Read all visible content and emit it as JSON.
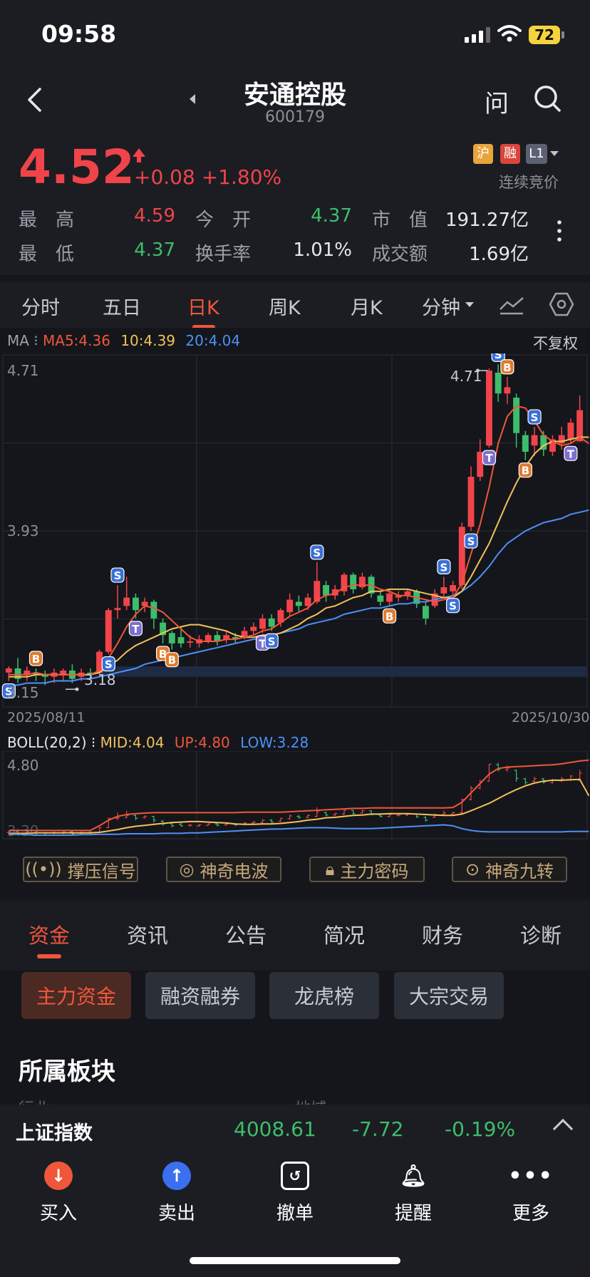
{
  "status_bar": {
    "time": "09:58",
    "battery": "72"
  },
  "header": {
    "title": "安通控股",
    "code": "600179",
    "ask_label": "问"
  },
  "quote": {
    "price": "4.52",
    "change": "+0.08 +1.80%",
    "badges": {
      "hu": "沪",
      "rong": "融",
      "level": "L1"
    },
    "status": "连续竞价",
    "stats": {
      "high_label": "最　高",
      "high": "4.59",
      "open_label": "今　开",
      "open": "4.37",
      "mktcap_label": "市　值",
      "mktcap": "191.27亿",
      "low_label": "最　低",
      "low": "4.37",
      "turnover_label": "换手率",
      "turnover": "1.01%",
      "amount_label": "成交额",
      "amount": "1.69亿"
    }
  },
  "kline_tabs": {
    "t1": "分时",
    "t2": "五日",
    "t3": "日K",
    "t4": "周K",
    "t5": "月K",
    "t6": "分钟"
  },
  "ma_legend": {
    "title": "MA",
    "ma5": "MA5:4.36",
    "ma10": "10:4.39",
    "ma20": "20:4.04",
    "fuquan": "不复权"
  },
  "chart_axes": {
    "y_top": "4.71",
    "y_mid": "3.93",
    "y_bottom": "3.15",
    "high_marker": "4.71",
    "low_marker": "3.18",
    "date_start": "2025/08/11",
    "date_end": "2025/10/30"
  },
  "boll_legend": {
    "title": "BOLL(20,2)",
    "mid": "MID:4.04",
    "up": "UP:4.80",
    "low": "LOW:3.28",
    "y_top": "4.80",
    "y_bottom": "3.30"
  },
  "indicator_buttons": {
    "b1": "撑压信号",
    "b2": "神奇电波",
    "b3": "主力密码",
    "b4": "神奇九转"
  },
  "section_tabs": {
    "s1": "资金",
    "s2": "资讯",
    "s3": "公告",
    "s4": "简况",
    "s5": "财务",
    "s6": "诊断"
  },
  "chips": {
    "c1": "主力资金",
    "c2": "融资融券",
    "c3": "龙虎榜",
    "c4": "大宗交易"
  },
  "section_title": "所属板块",
  "faded_labels": {
    "left": "行业",
    "right": "地域"
  },
  "index_bar": {
    "name": "上证指数",
    "value": "4008.61",
    "change": "-7.72",
    "pct": "-0.19%"
  },
  "toolbar": {
    "buy": "买入",
    "sell": "卖出",
    "cancel": "撤单",
    "alert": "提醒",
    "more": "更多"
  },
  "colors": {
    "up": "#f0444a",
    "down": "#3dbd6b",
    "accent": "#f0563a",
    "ma5": "#f0563a",
    "ma10": "#f3c15a",
    "ma20": "#4f8ff7"
  },
  "chart_data": {
    "type": "candlestick",
    "x_range": [
      "2025/08/11",
      "2025/10/30"
    ],
    "ylim": [
      3.15,
      4.71
    ],
    "candles": [
      {
        "o": 3.26,
        "c": 3.28,
        "h": 3.29,
        "l": 3.22
      },
      {
        "o": 3.28,
        "c": 3.23,
        "h": 3.33,
        "l": 3.21
      },
      {
        "o": 3.25,
        "c": 3.27,
        "h": 3.29,
        "l": 3.22
      },
      {
        "o": 3.26,
        "c": 3.25,
        "h": 3.28,
        "l": 3.22
      },
      {
        "o": 3.25,
        "c": 3.24,
        "h": 3.27,
        "l": 3.2
      },
      {
        "o": 3.24,
        "c": 3.26,
        "h": 3.28,
        "l": 3.21
      },
      {
        "o": 3.25,
        "c": 3.27,
        "h": 3.28,
        "l": 3.22
      },
      {
        "o": 3.27,
        "c": 3.23,
        "h": 3.3,
        "l": 3.21
      },
      {
        "o": 3.24,
        "c": 3.26,
        "h": 3.28,
        "l": 3.22
      },
      {
        "o": 3.26,
        "c": 3.25,
        "h": 3.28,
        "l": 3.23
      },
      {
        "o": 3.26,
        "c": 3.36,
        "h": 3.37,
        "l": 3.25
      },
      {
        "o": 3.36,
        "c": 3.56,
        "h": 3.57,
        "l": 3.35
      },
      {
        "o": 3.56,
        "c": 3.57,
        "h": 3.68,
        "l": 3.52
      },
      {
        "o": 3.58,
        "c": 3.62,
        "h": 3.72,
        "l": 3.56
      },
      {
        "o": 3.62,
        "c": 3.56,
        "h": 3.64,
        "l": 3.52
      },
      {
        "o": 3.58,
        "c": 3.6,
        "h": 3.62,
        "l": 3.55
      },
      {
        "o": 3.6,
        "c": 3.52,
        "h": 3.61,
        "l": 3.47
      },
      {
        "o": 3.5,
        "c": 3.44,
        "h": 3.52,
        "l": 3.4
      },
      {
        "o": 3.45,
        "c": 3.4,
        "h": 3.46,
        "l": 3.37
      },
      {
        "o": 3.43,
        "c": 3.4,
        "h": 3.48,
        "l": 3.38
      },
      {
        "o": 3.41,
        "c": 3.41,
        "h": 3.44,
        "l": 3.38
      },
      {
        "o": 3.4,
        "c": 3.42,
        "h": 3.44,
        "l": 3.38
      },
      {
        "o": 3.41,
        "c": 3.44,
        "h": 3.45,
        "l": 3.4
      },
      {
        "o": 3.44,
        "c": 3.41,
        "h": 3.46,
        "l": 3.39
      },
      {
        "o": 3.42,
        "c": 3.44,
        "h": 3.46,
        "l": 3.4
      },
      {
        "o": 3.43,
        "c": 3.42,
        "h": 3.45,
        "l": 3.4
      },
      {
        "o": 3.43,
        "c": 3.46,
        "h": 3.48,
        "l": 3.42
      },
      {
        "o": 3.46,
        "c": 3.48,
        "h": 3.5,
        "l": 3.44
      },
      {
        "o": 3.47,
        "c": 3.52,
        "h": 3.54,
        "l": 3.45
      },
      {
        "o": 3.52,
        "c": 3.48,
        "h": 3.54,
        "l": 3.46
      },
      {
        "o": 3.5,
        "c": 3.56,
        "h": 3.57,
        "l": 3.48
      },
      {
        "o": 3.55,
        "c": 3.61,
        "h": 3.64,
        "l": 3.53
      },
      {
        "o": 3.6,
        "c": 3.58,
        "h": 3.63,
        "l": 3.55
      },
      {
        "o": 3.58,
        "c": 3.62,
        "h": 3.64,
        "l": 3.56
      },
      {
        "o": 3.6,
        "c": 3.7,
        "h": 3.79,
        "l": 3.59
      },
      {
        "o": 3.68,
        "c": 3.63,
        "h": 3.7,
        "l": 3.6
      },
      {
        "o": 3.63,
        "c": 3.66,
        "h": 3.68,
        "l": 3.61
      },
      {
        "o": 3.65,
        "c": 3.73,
        "h": 3.74,
        "l": 3.63
      },
      {
        "o": 3.73,
        "c": 3.66,
        "h": 3.74,
        "l": 3.64
      },
      {
        "o": 3.67,
        "c": 3.72,
        "h": 3.74,
        "l": 3.66
      },
      {
        "o": 3.72,
        "c": 3.64,
        "h": 3.73,
        "l": 3.62
      },
      {
        "o": 3.63,
        "c": 3.6,
        "h": 3.65,
        "l": 3.58
      },
      {
        "o": 3.6,
        "c": 3.64,
        "h": 3.66,
        "l": 3.58
      },
      {
        "o": 3.62,
        "c": 3.63,
        "h": 3.65,
        "l": 3.6
      },
      {
        "o": 3.63,
        "c": 3.65,
        "h": 3.66,
        "l": 3.61
      },
      {
        "o": 3.65,
        "c": 3.59,
        "h": 3.66,
        "l": 3.57
      },
      {
        "o": 3.58,
        "c": 3.52,
        "h": 3.6,
        "l": 3.49
      },
      {
        "o": 3.58,
        "c": 3.64,
        "h": 3.66,
        "l": 3.57
      },
      {
        "o": 3.64,
        "c": 3.67,
        "h": 3.72,
        "l": 3.62
      },
      {
        "o": 3.65,
        "c": 3.68,
        "h": 3.7,
        "l": 3.63
      },
      {
        "o": 3.68,
        "c": 3.96,
        "h": 3.98,
        "l": 3.66
      },
      {
        "o": 3.96,
        "c": 4.2,
        "h": 4.25,
        "l": 3.94
      },
      {
        "o": 4.2,
        "c": 4.32,
        "h": 4.38,
        "l": 4.18
      },
      {
        "o": 4.35,
        "c": 4.71,
        "h": 4.72,
        "l": 4.34
      },
      {
        "o": 4.7,
        "c": 4.6,
        "h": 4.74,
        "l": 4.56
      },
      {
        "o": 4.6,
        "c": 4.63,
        "h": 4.68,
        "l": 4.55
      },
      {
        "o": 4.58,
        "c": 4.41,
        "h": 4.6,
        "l": 4.34
      },
      {
        "o": 4.4,
        "c": 4.32,
        "h": 4.42,
        "l": 4.28
      },
      {
        "o": 4.35,
        "c": 4.4,
        "h": 4.44,
        "l": 4.3
      },
      {
        "o": 4.4,
        "c": 4.33,
        "h": 4.42,
        "l": 4.3
      },
      {
        "o": 4.32,
        "c": 4.38,
        "h": 4.4,
        "l": 4.3
      },
      {
        "o": 4.36,
        "c": 4.4,
        "h": 4.44,
        "l": 4.33
      },
      {
        "o": 4.38,
        "c": 4.46,
        "h": 4.48,
        "l": 4.36
      },
      {
        "o": 4.37,
        "c": 4.52,
        "h": 4.59,
        "l": 4.37
      }
    ],
    "ma5": [
      3.25,
      3.25,
      3.25,
      3.26,
      3.25,
      3.25,
      3.25,
      3.25,
      3.25,
      3.25,
      3.27,
      3.33,
      3.4,
      3.48,
      3.54,
      3.58,
      3.57,
      3.55,
      3.51,
      3.47,
      3.43,
      3.41,
      3.41,
      3.41,
      3.42,
      3.42,
      3.43,
      3.44,
      3.46,
      3.47,
      3.5,
      3.53,
      3.55,
      3.57,
      3.61,
      3.63,
      3.64,
      3.67,
      3.68,
      3.68,
      3.68,
      3.66,
      3.65,
      3.63,
      3.63,
      3.62,
      3.61,
      3.6,
      3.61,
      3.62,
      3.69,
      3.83,
      3.97,
      4.15,
      4.36,
      4.49,
      4.54,
      4.53,
      4.47,
      4.4,
      4.37,
      4.35,
      4.36,
      4.39,
      4.36
    ],
    "ma10": [
      3.24,
      3.24,
      3.24,
      3.25,
      3.25,
      3.25,
      3.25,
      3.25,
      3.25,
      3.25,
      3.26,
      3.29,
      3.32,
      3.36,
      3.39,
      3.41,
      3.43,
      3.45,
      3.47,
      3.48,
      3.49,
      3.49,
      3.48,
      3.47,
      3.46,
      3.44,
      3.43,
      3.43,
      3.44,
      3.44,
      3.45,
      3.47,
      3.49,
      3.52,
      3.54,
      3.57,
      3.58,
      3.6,
      3.62,
      3.63,
      3.65,
      3.65,
      3.66,
      3.66,
      3.66,
      3.65,
      3.64,
      3.63,
      3.62,
      3.62,
      3.65,
      3.72,
      3.8,
      3.88,
      3.98,
      4.08,
      4.17,
      4.25,
      4.31,
      4.35,
      4.37,
      4.37,
      4.38,
      4.39,
      4.39
    ],
    "ma20": [
      3.2,
      3.2,
      3.21,
      3.21,
      3.21,
      3.22,
      3.22,
      3.22,
      3.23,
      3.23,
      3.24,
      3.25,
      3.26,
      3.27,
      3.28,
      3.3,
      3.31,
      3.32,
      3.33,
      3.34,
      3.35,
      3.36,
      3.37,
      3.38,
      3.39,
      3.4,
      3.41,
      3.42,
      3.43,
      3.44,
      3.45,
      3.46,
      3.47,
      3.49,
      3.5,
      3.51,
      3.52,
      3.54,
      3.55,
      3.56,
      3.57,
      3.57,
      3.58,
      3.59,
      3.59,
      3.6,
      3.6,
      3.61,
      3.62,
      3.63,
      3.65,
      3.68,
      3.72,
      3.77,
      3.83,
      3.88,
      3.91,
      3.94,
      3.96,
      3.98,
      3.99,
      4.0,
      4.02,
      4.03,
      4.04
    ],
    "signals": [
      {
        "i": 0,
        "t": "S",
        "p": "below"
      },
      {
        "i": 3,
        "t": "B",
        "p": "above"
      },
      {
        "i": 11,
        "t": "S",
        "p": "below"
      },
      {
        "i": 12,
        "t": "S",
        "p": "above"
      },
      {
        "i": 14,
        "t": "T",
        "p": "below"
      },
      {
        "i": 17,
        "t": "B",
        "p": "below"
      },
      {
        "i": 18,
        "t": "B",
        "p": "below"
      },
      {
        "i": 28,
        "t": "T",
        "p": "below"
      },
      {
        "i": 29,
        "t": "S",
        "p": "below"
      },
      {
        "i": 34,
        "t": "S",
        "p": "above"
      },
      {
        "i": 42,
        "t": "B",
        "p": "below"
      },
      {
        "i": 48,
        "t": "S",
        "p": "above"
      },
      {
        "i": 49,
        "t": "S",
        "p": "below"
      },
      {
        "i": 51,
        "t": "S",
        "p": "below"
      },
      {
        "i": 53,
        "t": "T",
        "p": "below"
      },
      {
        "i": 54,
        "t": "S",
        "p": "above"
      },
      {
        "i": 55,
        "t": "B",
        "p": "above"
      },
      {
        "i": 57,
        "t": "B",
        "p": "below"
      },
      {
        "i": 58,
        "t": "S",
        "p": "above"
      },
      {
        "i": 62,
        "t": "T",
        "p": "below"
      }
    ],
    "boll": {
      "ylim": [
        3.2,
        4.9
      ],
      "up": [
        3.3,
        3.3,
        3.3,
        3.3,
        3.3,
        3.3,
        3.3,
        3.3,
        3.3,
        3.3,
        3.4,
        3.52,
        3.6,
        3.64,
        3.66,
        3.67,
        3.68,
        3.68,
        3.68,
        3.68,
        3.68,
        3.68,
        3.68,
        3.68,
        3.68,
        3.68,
        3.69,
        3.69,
        3.69,
        3.69,
        3.69,
        3.7,
        3.71,
        3.72,
        3.73,
        3.74,
        3.75,
        3.76,
        3.77,
        3.77,
        3.78,
        3.78,
        3.78,
        3.78,
        3.78,
        3.78,
        3.78,
        3.78,
        3.78,
        3.79,
        3.9,
        4.1,
        4.3,
        4.5,
        4.62,
        4.65,
        4.66,
        4.67,
        4.68,
        4.69,
        4.7,
        4.72,
        4.75,
        4.78,
        4.8
      ],
      "mid": [
        3.24,
        3.24,
        3.24,
        3.25,
        3.25,
        3.25,
        3.25,
        3.25,
        3.25,
        3.25,
        3.26,
        3.29,
        3.32,
        3.36,
        3.39,
        3.41,
        3.43,
        3.45,
        3.47,
        3.48,
        3.49,
        3.49,
        3.48,
        3.47,
        3.46,
        3.44,
        3.43,
        3.43,
        3.44,
        3.44,
        3.45,
        3.47,
        3.49,
        3.52,
        3.54,
        3.57,
        3.58,
        3.6,
        3.62,
        3.63,
        3.65,
        3.65,
        3.66,
        3.66,
        3.66,
        3.65,
        3.64,
        3.63,
        3.62,
        3.62,
        3.65,
        3.72,
        3.8,
        3.88,
        3.98,
        4.08,
        4.17,
        4.25,
        4.31,
        4.35,
        4.37,
        4.37,
        4.38,
        4.39,
        4.04
      ],
      "low": [
        3.22,
        3.22,
        3.21,
        3.2,
        3.2,
        3.2,
        3.2,
        3.2,
        3.21,
        3.21,
        3.22,
        3.22,
        3.22,
        3.23,
        3.23,
        3.23,
        3.23,
        3.24,
        3.24,
        3.24,
        3.25,
        3.25,
        3.26,
        3.27,
        3.28,
        3.29,
        3.3,
        3.31,
        3.32,
        3.33,
        3.33,
        3.34,
        3.35,
        3.36,
        3.36,
        3.36,
        3.35,
        3.34,
        3.34,
        3.34,
        3.34,
        3.35,
        3.36,
        3.37,
        3.38,
        3.39,
        3.4,
        3.41,
        3.42,
        3.4,
        3.34,
        3.3,
        3.28,
        3.27,
        3.27,
        3.27,
        3.27,
        3.27,
        3.27,
        3.27,
        3.27,
        3.27,
        3.28,
        3.28,
        3.28
      ]
    }
  }
}
